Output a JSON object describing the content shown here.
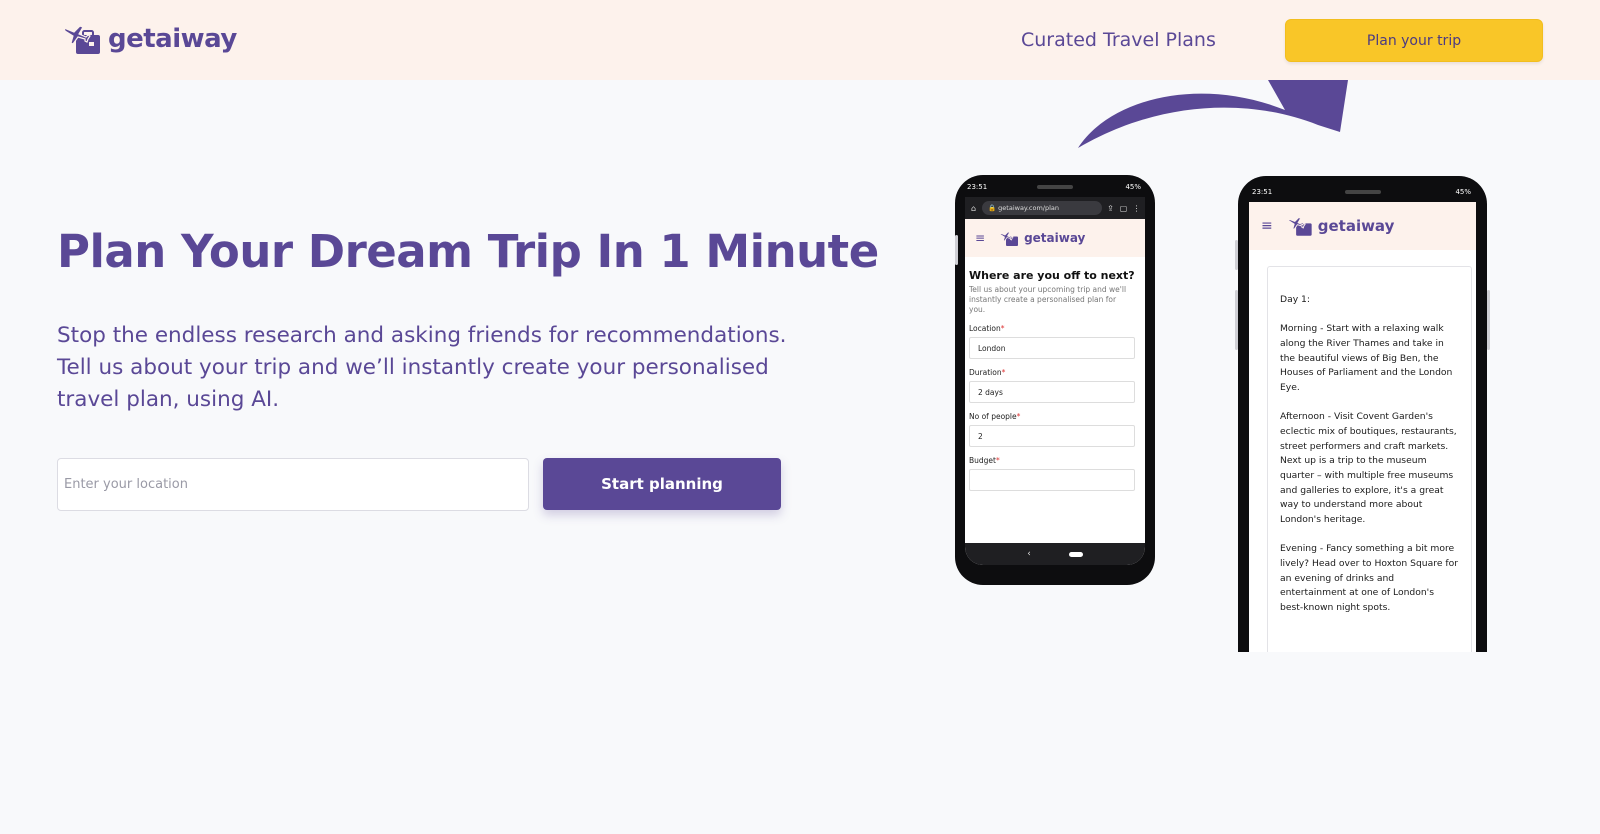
{
  "header": {
    "brand": "getaiway",
    "nav_link": "Curated Travel Plans",
    "cta_label": "Plan your trip"
  },
  "hero": {
    "title": "Plan Your Dream Trip In 1 Minute",
    "subtitle": "Stop the endless research and asking friends for recommendations. Tell us about your trip and we’ll instantly create your personalised travel plan, using AI.",
    "location_placeholder": "Enter your location",
    "start_label": "Start planning"
  },
  "phone_left": {
    "time": "23:51",
    "battery": "45%",
    "url": "getaiway.com/plan",
    "brand": "getaiway",
    "question": "Where are you off to next?",
    "hint": "Tell us about your upcoming trip and we'll instantly create a personalised plan for you.",
    "fields": [
      {
        "label": "Location",
        "value": "London"
      },
      {
        "label": "Duration",
        "value": "2 days"
      },
      {
        "label": "No of people",
        "value": "2"
      },
      {
        "label": "Budget",
        "value": ""
      }
    ]
  },
  "phone_right": {
    "time": "23:51",
    "battery": "45%",
    "brand": "getaiway",
    "day": "Day 1:",
    "morning": "Morning - Start with a relaxing walk along the River Thames and take in the beautiful views of Big Ben, the Houses of Parliament and the London Eye.",
    "afternoon": "Afternoon - Visit Covent Garden's eclectic mix of boutiques, restaurants, street performers and craft markets. Next up is a trip to the museum quarter – with multiple free museums and galleries to explore, it's a great way to understand more about London's heritage.",
    "evening": "Evening - Fancy something a bit more lively? Head over to Hoxton Square for an evening of drinks and entertainment at one of London's best-known night spots."
  },
  "colors": {
    "brand_purple": "#5a4896",
    "cta_yellow": "#f9c628",
    "header_bg": "#fdf2ec",
    "page_bg": "#f8f9fb"
  },
  "icons": [
    "plane-suitcase-logo-icon",
    "curved-arrow-icon",
    "menu-icon",
    "home-icon",
    "lock-icon",
    "share-icon",
    "back-icon"
  ]
}
